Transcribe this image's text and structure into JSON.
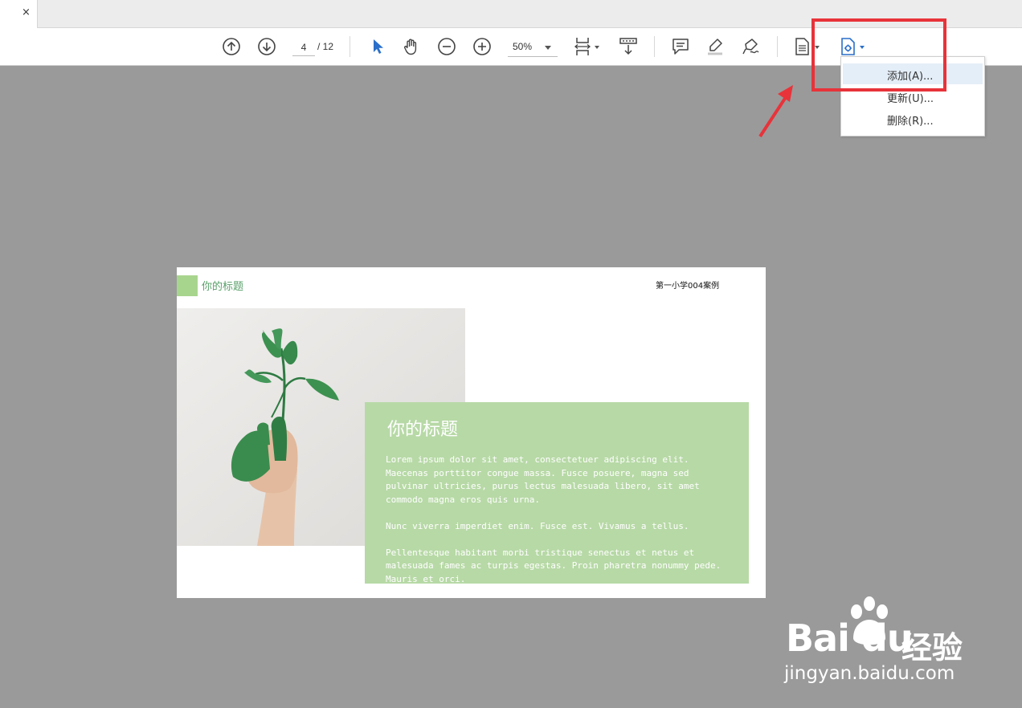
{
  "tab": {
    "close_glyph": "×"
  },
  "toolbar": {
    "page_current": "4",
    "page_total": "/ 12",
    "zoom": "50%",
    "icons": [
      "prev-page-icon",
      "next-page-icon",
      "select-cursor-icon",
      "hand-tool-icon",
      "zoom-out-icon",
      "zoom-in-icon",
      "fit-page-icon",
      "scroll-mode-icon",
      "comment-icon",
      "highlight-icon",
      "sign-icon",
      "page-menu-icon",
      "attachment-menu-icon"
    ]
  },
  "menu": {
    "items": [
      "添加(A)...",
      "更新(U)...",
      "删除(R)..."
    ]
  },
  "annotation": {
    "color": "#e8333a"
  },
  "slide": {
    "header_title": "你的标题",
    "header_right": "第一小学004案例",
    "panel_title": "你的标题",
    "paragraphs": [
      "Lorem ipsum dolor sit amet, consectetuer adipiscing elit.\nMaecenas porttitor congue massa. Fusce posuere, magna sed\npulvinar ultricies, purus lectus malesuada libero, sit amet\ncommodo magna eros quis urna.",
      "Nunc viverra imperdiet enim. Fusce est. Vivamus a tellus.",
      "Pellentesque habitant morbi tristique senectus et netus et\nmalesuada fames ac turpis egestas. Proin pharetra nonummy pede.\nMauris et orci."
    ],
    "accent_color": "#a8d58e",
    "panel_color": "#b7d9a6"
  },
  "watermark": {
    "logo": "Bai du",
    "cn": "经验",
    "url": "jingyan.baidu.com"
  }
}
